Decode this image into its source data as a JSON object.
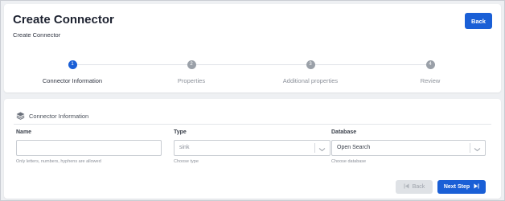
{
  "header": {
    "title": "Create Connector",
    "subtitle": "Create Connector",
    "back_label": "Back"
  },
  "stepper": {
    "steps": [
      {
        "number": "1",
        "label": "Connector Information",
        "active": true
      },
      {
        "number": "2",
        "label": "Properties",
        "active": false
      },
      {
        "number": "3",
        "label": "Additional properties",
        "active": false
      },
      {
        "number": "4",
        "label": "Review",
        "active": false
      }
    ]
  },
  "section": {
    "title": "Connector Information",
    "icon": "layers-icon"
  },
  "form": {
    "name": {
      "label": "Name",
      "value": "",
      "helper": "Only letters, numbers, hyphens are allowed"
    },
    "type": {
      "label": "Type",
      "value": "sink",
      "helper": "Choose type"
    },
    "database": {
      "label": "Database",
      "value": "Open Search",
      "helper": "Choose database"
    }
  },
  "footer": {
    "back_label": "Back",
    "next_label": "Next Step"
  },
  "colors": {
    "primary": "#1a5fd6",
    "inactive_step": "#9aa0a8"
  }
}
